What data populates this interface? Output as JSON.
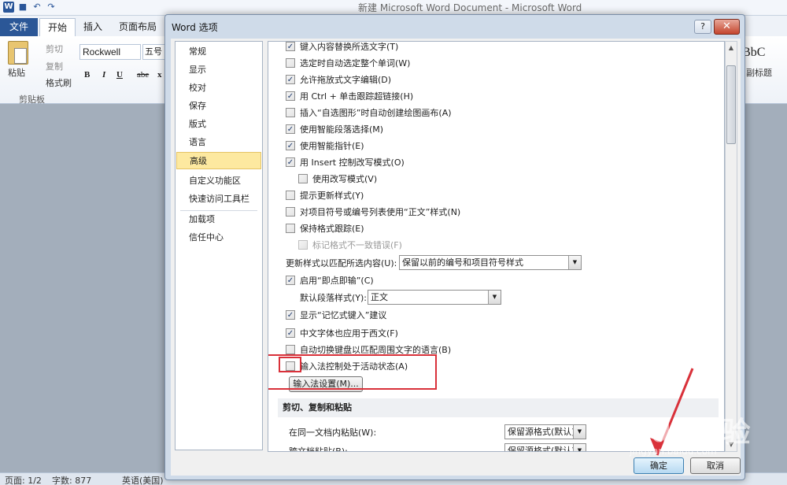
{
  "app": {
    "title": "新建 Microsoft Word Document  -  Microsoft Word",
    "qat": {
      "logo": "W",
      "save_icon": "save-icon",
      "undo_icon": "undo-icon",
      "redo_icon": "redo-icon"
    }
  },
  "ribbon": {
    "tabs": [
      "文件",
      "开始",
      "插入",
      "页面布局"
    ],
    "clipboard": {
      "paste": "粘贴",
      "cut": "剪切",
      "copy": "复制",
      "format_painter": "格式刷",
      "group": "剪贴板"
    },
    "font": {
      "name": "Rockwell",
      "size": "五号",
      "bold": "B",
      "italic": "I",
      "underline": "U",
      "strike": "abe",
      "sub": "x"
    },
    "styles": {
      "preview": "aBbC",
      "label": "副标题"
    }
  },
  "dialog": {
    "title": "Word 选项",
    "help": "?",
    "close": "✕",
    "nav": [
      "常规",
      "显示",
      "校对",
      "保存",
      "版式",
      "语言",
      "高级",
      "自定义功能区",
      "快速访问工具栏",
      "加载项",
      "信任中心"
    ],
    "nav_active": "高级",
    "options": [
      {
        "label": "键入内容替换所选文字(T)",
        "checked": true
      },
      {
        "label": "选定时自动选定整个单词(W)",
        "checked": false
      },
      {
        "label": "允许拖放式文字编辑(D)",
        "checked": true
      },
      {
        "label": "用 Ctrl + 单击跟踪超链接(H)",
        "checked": true
      },
      {
        "label": "插入“自选图形”时自动创建绘图画布(A)",
        "checked": false
      },
      {
        "label": "使用智能段落选择(M)",
        "checked": true
      },
      {
        "label": "使用智能指针(E)",
        "checked": true
      },
      {
        "label": "用 Insert 控制改写模式(O)",
        "checked": true
      },
      {
        "label": "使用改写模式(V)",
        "checked": false
      },
      {
        "label": "提示更新样式(Y)",
        "checked": false
      },
      {
        "label": "对项目符号或编号列表使用“正文”样式(N)",
        "checked": false
      },
      {
        "label": "保持格式跟踪(E)",
        "checked": false
      },
      {
        "label": "标记格式不一致错误(F)",
        "checked": false,
        "disabled": true
      }
    ],
    "update_style_label": "更新样式以匹配所选内容(U):",
    "update_style_value": "保留以前的编号和项目符号样式",
    "click_type": {
      "label": "启用“即点即输”(C)",
      "checked": true
    },
    "default_para_label": "默认段落样式(Y):",
    "default_para_value": "正文",
    "options2": [
      {
        "label": "显示“记忆式键入”建议",
        "checked": true
      },
      {
        "label": "中文字体也应用于西文(F)",
        "checked": true
      },
      {
        "label": "自动切换键盘以匹配周围文字的语言(B)",
        "checked": false
      },
      {
        "label": "输入法控制处于活动状态(A)",
        "checked": false
      }
    ],
    "ime_button": "输入法设置(M)...",
    "section_cut_copy": "剪切、复制和粘贴",
    "paste_same_doc_label": "在同一文档内粘贴(W):",
    "paste_same_doc_value": "保留源格式(默认)",
    "paste_cross_doc_label": "跨文档粘贴(B):",
    "paste_cross_doc_value": "保留源格式(默认)",
    "ok": "确定",
    "cancel": "取消"
  },
  "status": {
    "page": "页面: 1/2",
    "words": "字数: 877",
    "lang": "英语(美国)"
  },
  "watermark": {
    "text": "Baidu经验",
    "url": "jingyan.baidu.com"
  },
  "colors": {
    "highlight": "#d9313a",
    "file_tab": "#2b5797",
    "active_nav": "#fde9a0"
  }
}
